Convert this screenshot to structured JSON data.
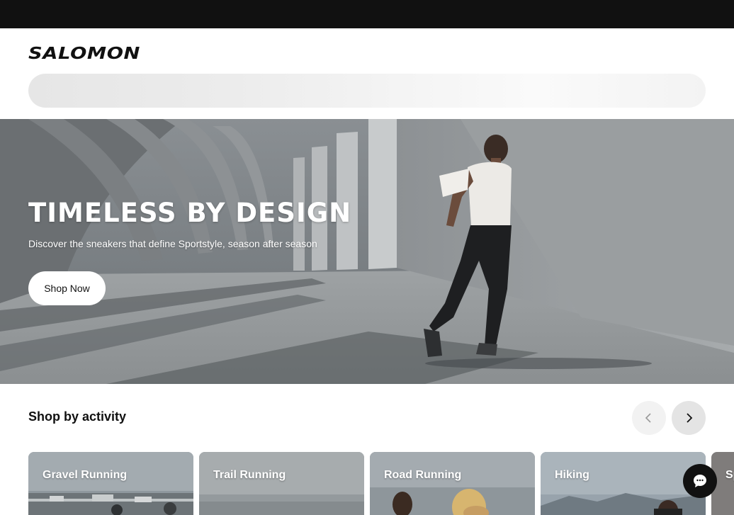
{
  "brand": {
    "name": "SALOMON"
  },
  "hero": {
    "title": "TIMELESS BY DESIGN",
    "subtitle": "Discover the sneakers that define Sportstyle, season after season",
    "cta_label": "Shop Now"
  },
  "activity_section": {
    "title": "Shop by activity",
    "cards": [
      {
        "label": "Gravel Running"
      },
      {
        "label": "Trail Running"
      },
      {
        "label": "Road Running"
      },
      {
        "label": "Hiking"
      },
      {
        "label": "Sp"
      }
    ]
  },
  "icons": {
    "carousel_prev": "chevron-left-icon",
    "carousel_next": "chevron-right-icon",
    "chat": "chat-bubble-icon"
  },
  "colors": {
    "top_bar": "#111111",
    "button_dark": "#111111",
    "button_light": "#ffffff"
  }
}
